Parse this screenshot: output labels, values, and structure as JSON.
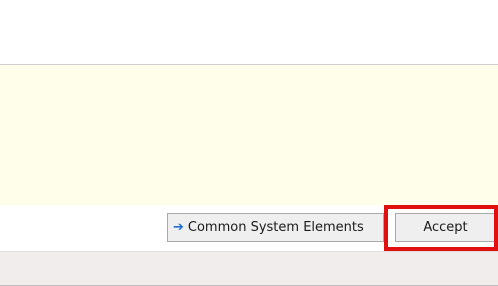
{
  "buttons": {
    "common_system_elements": {
      "icon": "arrow-right-icon",
      "icon_glyph": "➔",
      "label": "Common System Elements"
    },
    "accept": {
      "label": "Accept"
    }
  },
  "colors": {
    "info_panel_bg": "#fffeea",
    "footer_bg": "#f1eded",
    "highlight": "#e01010",
    "arrow": "#1f6fd2"
  }
}
